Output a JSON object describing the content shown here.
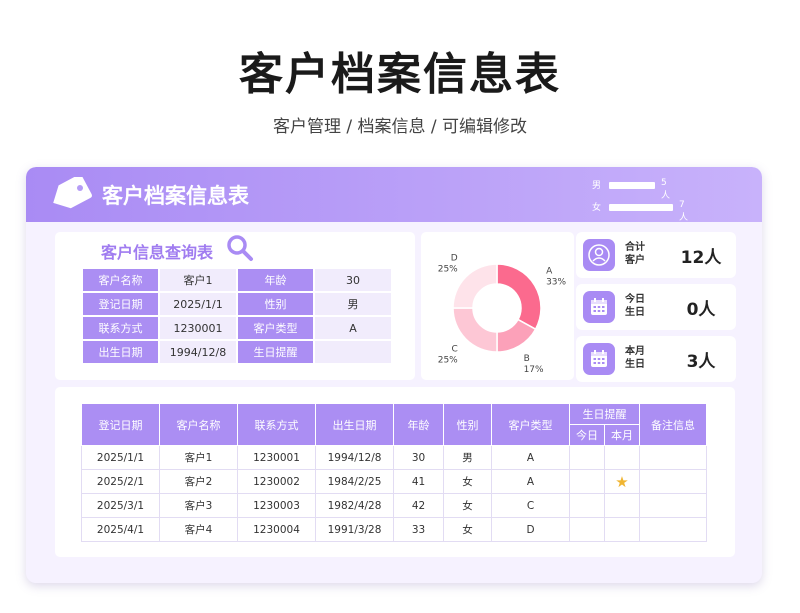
{
  "header": {
    "title": "客户档案信息表",
    "subtitle": "客户管理 / 档案信息 /  可编辑修改"
  },
  "banner": {
    "title": "客户档案信息表",
    "gender": [
      {
        "label": "男",
        "count": "5人",
        "fraction": 0.42
      },
      {
        "label": "女",
        "count": "7人",
        "fraction": 0.58
      }
    ]
  },
  "query": {
    "title": "客户信息查询表",
    "rows": [
      {
        "k1": "客户名称",
        "v1": "客户1",
        "k2": "年龄",
        "v2": "30"
      },
      {
        "k1": "登记日期",
        "v1": "2025/1/1",
        "k2": "性别",
        "v2": "男"
      },
      {
        "k1": "联系方式",
        "v1": "1230001",
        "k2": "客户类型",
        "v2": "A"
      },
      {
        "k1": "出生日期",
        "v1": "1994/12/8",
        "k2": "生日提醒",
        "v2": ""
      }
    ]
  },
  "chart_data": {
    "type": "pie",
    "categories": [
      "A",
      "B",
      "C",
      "D"
    ],
    "values": [
      33,
      17,
      25,
      25
    ],
    "labels": [
      "33%",
      "17%",
      "25%",
      "25%"
    ],
    "colors": [
      "#fb6a8e",
      "#fca1b9",
      "#fdc7d5",
      "#fee3ea"
    ]
  },
  "stats": [
    {
      "label": "合计客户",
      "value": "12人",
      "icon": "user-icon"
    },
    {
      "label": "今日生日",
      "value": "0人",
      "icon": "calendar-icon"
    },
    {
      "label": "本月生日",
      "value": "3人",
      "icon": "calendar-icon"
    }
  ],
  "table": {
    "headers": {
      "reg_date": "登记日期",
      "name": "客户名称",
      "contact": "联系方式",
      "birth": "出生日期",
      "age": "年龄",
      "gender": "性别",
      "type": "客户类型",
      "reminder": "生日提醒",
      "today": "今日",
      "month": "本月",
      "note": "备注信息"
    },
    "rows": [
      {
        "reg_date": "2025/1/1",
        "name": "客户1",
        "contact": "1230001",
        "birth": "1994/12/8",
        "age": "30",
        "gender": "男",
        "type": "A",
        "today": "",
        "month": "",
        "note": ""
      },
      {
        "reg_date": "2025/2/1",
        "name": "客户2",
        "contact": "1230002",
        "birth": "1984/2/25",
        "age": "41",
        "gender": "女",
        "type": "A",
        "today": "",
        "month": "★",
        "note": ""
      },
      {
        "reg_date": "2025/3/1",
        "name": "客户3",
        "contact": "1230003",
        "birth": "1982/4/28",
        "age": "42",
        "gender": "女",
        "type": "C",
        "today": "",
        "month": "",
        "note": ""
      },
      {
        "reg_date": "2025/4/1",
        "name": "客户4",
        "contact": "1230004",
        "birth": "1991/3/28",
        "age": "33",
        "gender": "女",
        "type": "D",
        "today": "",
        "month": "",
        "note": ""
      }
    ]
  }
}
